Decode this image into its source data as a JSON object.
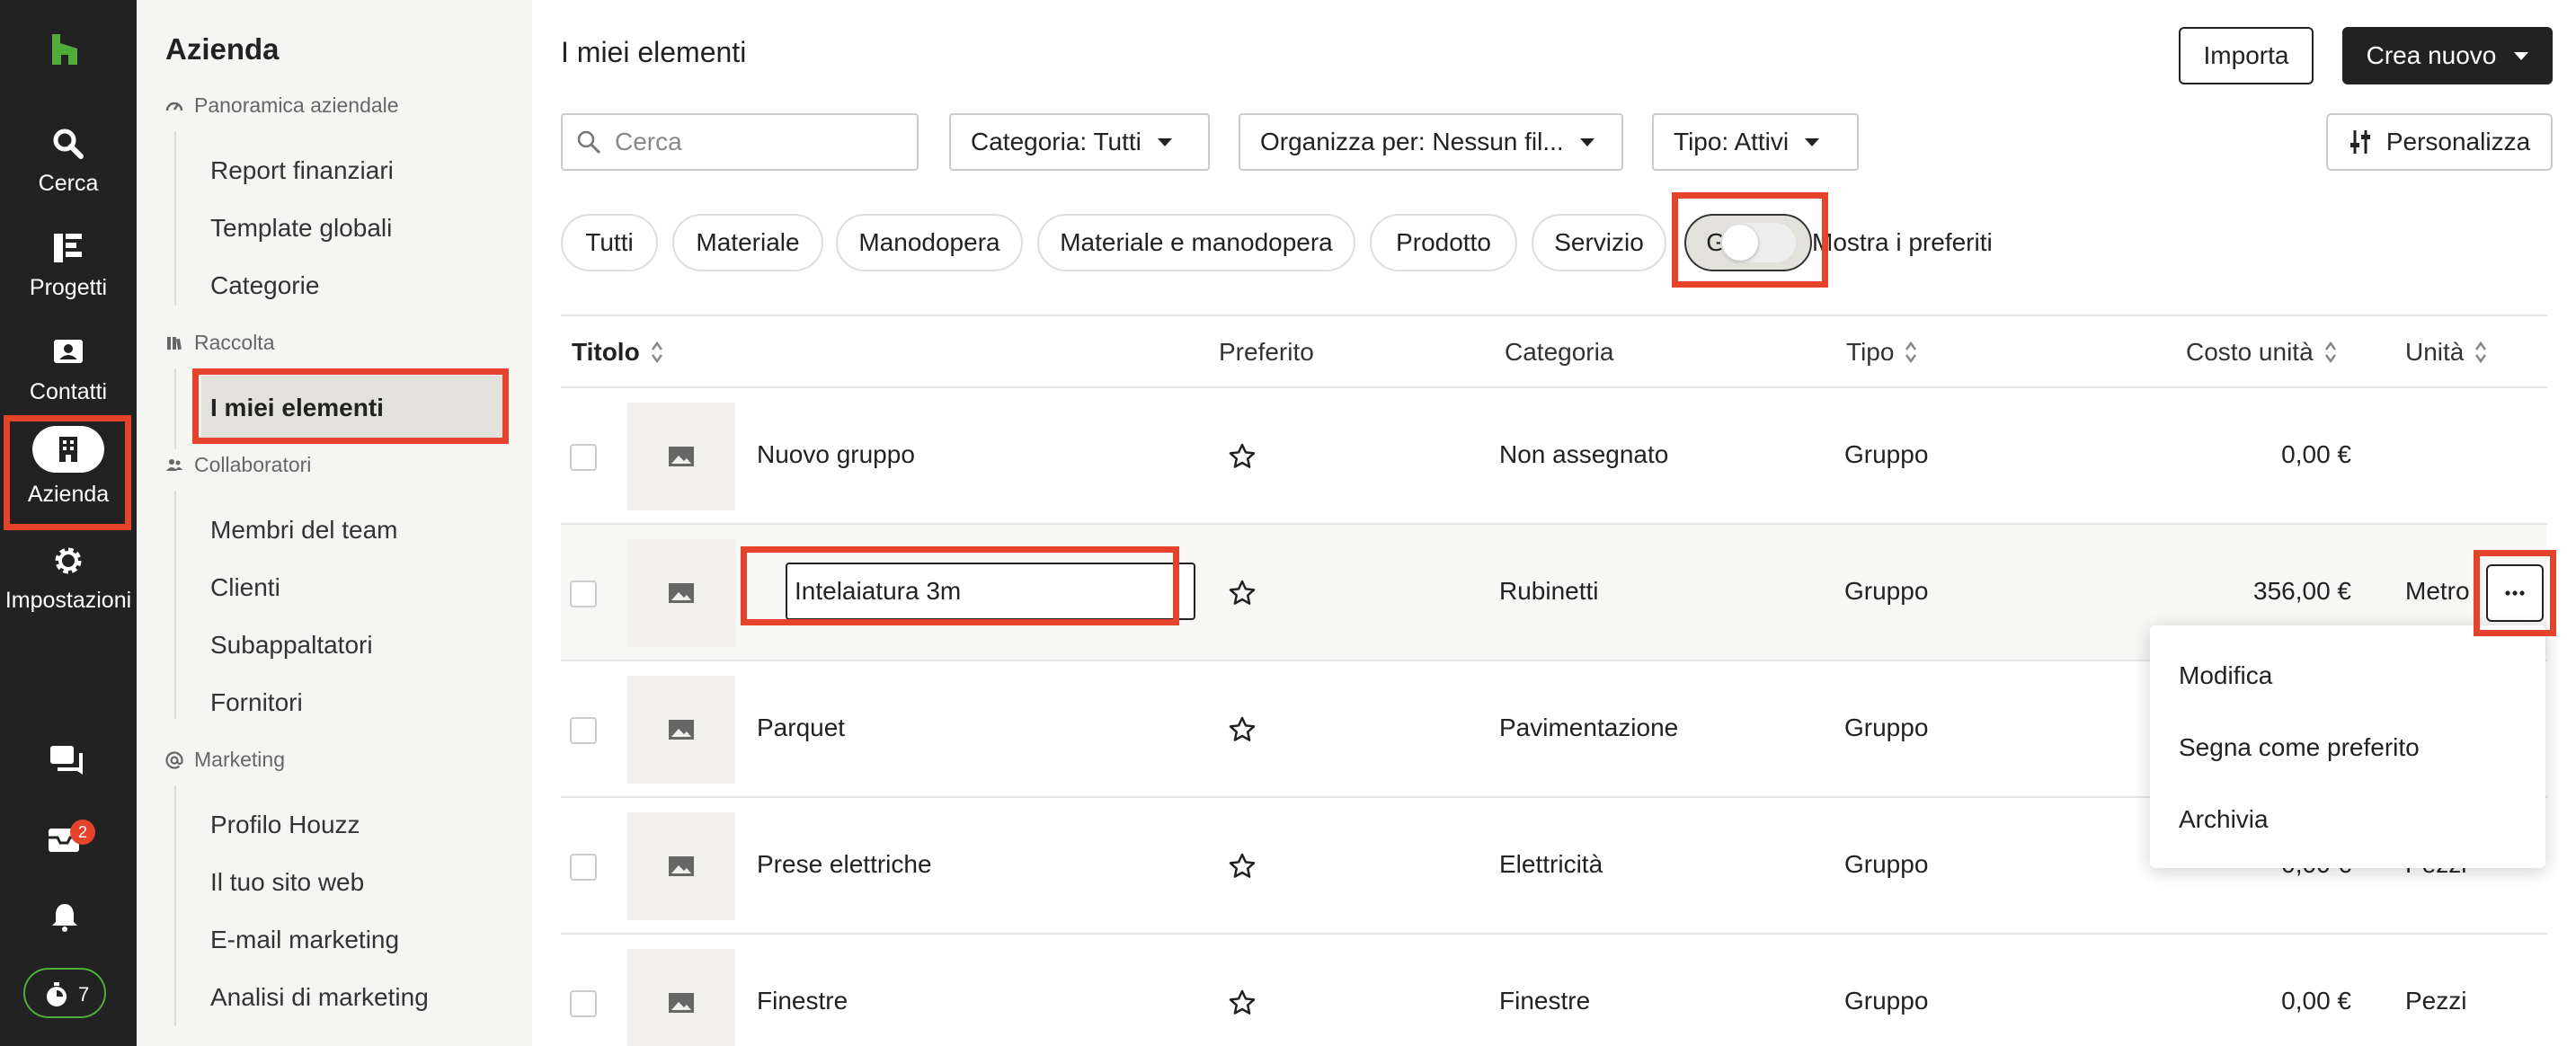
{
  "rail": {
    "items": [
      {
        "label": "Cerca",
        "icon": "search-icon"
      },
      {
        "label": "Progetti",
        "icon": "projects-icon"
      },
      {
        "label": "Contatti",
        "icon": "contacts-icon"
      },
      {
        "label": "Azienda",
        "icon": "building-icon"
      },
      {
        "label": "Impostazioni",
        "icon": "gear-icon"
      }
    ],
    "inbox_badge": "2",
    "timer_count": "7"
  },
  "sidebar": {
    "title": "Azienda",
    "sections": [
      {
        "label": "Panoramica aziendale",
        "items": [
          "Report finanziari",
          "Template globali",
          "Categorie"
        ]
      },
      {
        "label": "Raccolta",
        "items": [
          "I miei elementi"
        ]
      },
      {
        "label": "Collaboratori",
        "items": [
          "Membri del team",
          "Clienti",
          "Subappaltatori",
          "Fornitori"
        ]
      },
      {
        "label": "Marketing",
        "items": [
          "Profilo Houzz",
          "Il tuo sito web",
          "E-mail marketing",
          "Analisi di marketing"
        ]
      }
    ],
    "active_item": "I miei elementi"
  },
  "header": {
    "title": "I miei elementi",
    "import_label": "Importa",
    "create_label": "Crea nuovo"
  },
  "filters": {
    "search_placeholder": "Cerca",
    "category": "Categoria: Tutti",
    "organize": "Organizza per: Nessun fil...",
    "type": "Tipo: Attivi",
    "customize": "Personalizza",
    "chips": [
      "Tutti",
      "Materiale",
      "Manodopera",
      "Materiale e manodopera",
      "Prodotto",
      "Servizio",
      "Gruppo"
    ],
    "active_chip": "Gruppo",
    "favorites_toggle": "Mostra i preferiti"
  },
  "table": {
    "columns": [
      "Titolo",
      "Preferito",
      "Categoria",
      "Tipo",
      "Costo unità",
      "Unità"
    ],
    "rows": [
      {
        "title": "Nuovo gruppo",
        "category": "Non assegnato",
        "type": "Gruppo",
        "cost": "0,00 €",
        "unit": ""
      },
      {
        "title": "Intelaiatura 3m",
        "category": "Rubinetti",
        "type": "Gruppo",
        "cost": "356,00 €",
        "unit": "Metro"
      },
      {
        "title": "Parquet",
        "category": "Pavimentazione",
        "type": "Gruppo",
        "cost": "",
        "unit": ""
      },
      {
        "title": "Prese elettriche",
        "category": "Elettricità",
        "type": "Gruppo",
        "cost": "0,00 €",
        "unit": "Pezzi"
      },
      {
        "title": "Finestre",
        "category": "Finestre",
        "type": "Gruppo",
        "cost": "0,00 €",
        "unit": "Pezzi"
      }
    ]
  },
  "context_menu": {
    "items": [
      "Modifica",
      "Segna come preferito",
      "Archivia"
    ]
  },
  "colors": {
    "rail_bg": "#222222",
    "sidebar_bg": "#f5f5f3",
    "highlight": "#e5432c",
    "brand_green": "#4fae3a"
  }
}
